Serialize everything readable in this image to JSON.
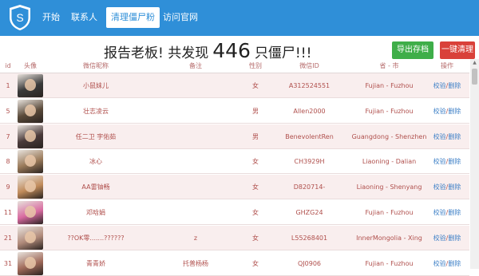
{
  "nav": {
    "logo_letter": "S",
    "items": [
      {
        "label": "开始"
      },
      {
        "label": "联系人"
      },
      {
        "label": "清理僵尸粉",
        "active": true
      },
      {
        "label": "访问官网"
      }
    ]
  },
  "headline": {
    "prefix": "报告老板! 共发现",
    "count": "446",
    "suffix": "只僵尸!!!"
  },
  "buttons": {
    "export": "导出存档",
    "clean": "一键清理"
  },
  "table": {
    "headers": {
      "id": "id",
      "avatar": "头像",
      "nick": "微信昵称",
      "note": "备注",
      "sex": "性别",
      "wxid": "微信ID",
      "region": "省 - 市",
      "op": "操作"
    },
    "op_verify": "校验",
    "op_sep": "/",
    "op_delete": "删除",
    "rows": [
      {
        "id": "1",
        "nick": "小鼠妹儿",
        "note": "",
        "sex": "女",
        "wxid": "A312524551",
        "region": "Fujian - Fuzhou",
        "avatar_color": "#3a3a3a"
      },
      {
        "id": "5",
        "nick": "壮志凌云",
        "note": "",
        "sex": "男",
        "wxid": "Allen2000",
        "region": "Fujian - Fuzhou",
        "avatar_color": "#5a4a3a"
      },
      {
        "id": "7",
        "nick": "任二卫 字佑茹",
        "note": "",
        "sex": "男",
        "wxid": "BenevolentRen",
        "region": "Guangdong - Shenzhen",
        "avatar_color": "#4a3a3a"
      },
      {
        "id": "8",
        "nick": "冰心",
        "note": "",
        "sex": "女",
        "wxid": "CH3929H",
        "region": "Liaoning - Dalian",
        "avatar_color": "#9a7a5a"
      },
      {
        "id": "9",
        "nick": "AA雷铀畅",
        "note": "",
        "sex": "女",
        "wxid": "D820714-",
        "region": "Liaoning - Shenyang",
        "avatar_color": "#c08a5a"
      },
      {
        "id": "11",
        "nick": "邓晗娟",
        "note": "",
        "sex": "女",
        "wxid": "GHZG24",
        "region": "Fujian - Fuzhou",
        "avatar_color": "#d86aa0"
      },
      {
        "id": "21",
        "nick": "??OK零.......??????",
        "note": "z",
        "sex": "女",
        "wxid": "L55268401",
        "region": "InnerMongolia - Xing",
        "avatar_color": "#b08a7a"
      },
      {
        "id": "31",
        "nick": "青青娇",
        "note": "托普杨杨",
        "sex": "女",
        "wxid": "QJ0906",
        "region": "Fujian - Fuzhou",
        "avatar_color": "#a06a5a"
      }
    ]
  },
  "scrollbar": {
    "up_arrow": "▲"
  }
}
